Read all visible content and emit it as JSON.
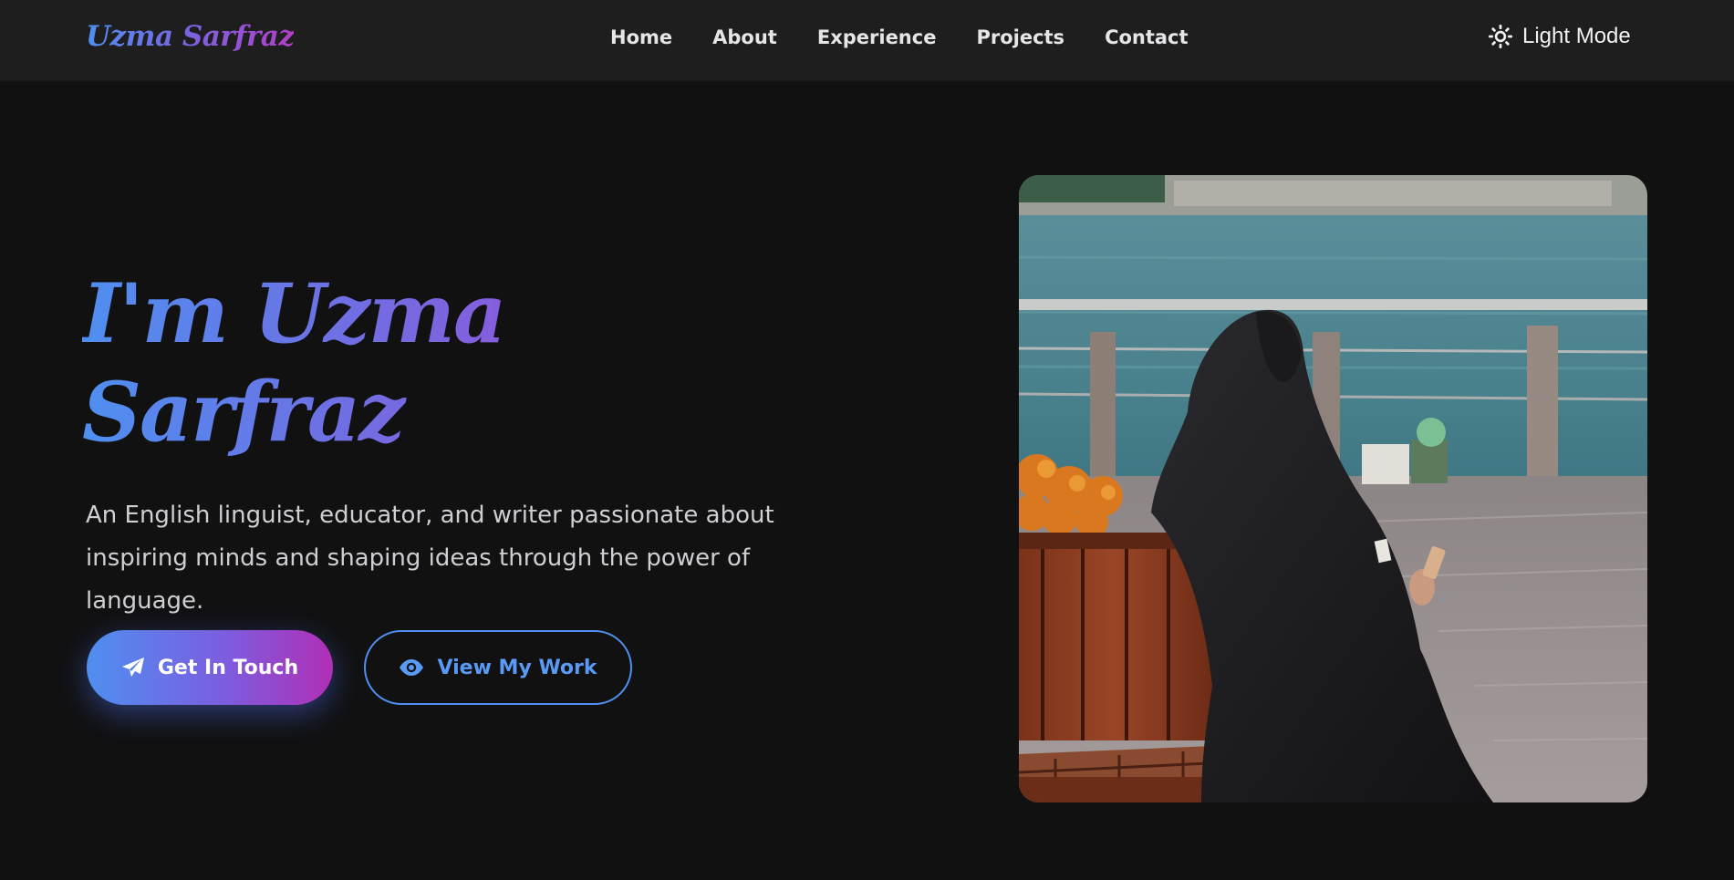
{
  "brand": {
    "logo_text": "Uzma Sarfraz",
    "gradient_start": "#4f8ff0",
    "gradient_mid": "#7a63e0",
    "gradient_end": "#b13fc6"
  },
  "nav": {
    "links": [
      "Home",
      "About",
      "Experience",
      "Projects",
      "Contact"
    ],
    "theme_toggle": {
      "icon": "sun-icon",
      "label": "Light Mode"
    }
  },
  "hero": {
    "title_line1": "I'm Uzma",
    "title_line2": "Sarfraz",
    "description": "An English linguist, educator, and writer passionate about inspiring minds and shaping ideas through the power of language.",
    "primary_button": {
      "icon": "paper-plane-icon",
      "label": "Get In Touch"
    },
    "secondary_button": {
      "icon": "eye-icon",
      "label": "View My Work"
    },
    "photo": {
      "subject": "woman in black abaya seated on wooden bench by the waterfront"
    }
  },
  "colors": {
    "page_background": "#111112",
    "navbar_background": "#1e1e1f",
    "accent_blue": "#4f8ff0",
    "accent_magenta": "#b12fb6"
  }
}
